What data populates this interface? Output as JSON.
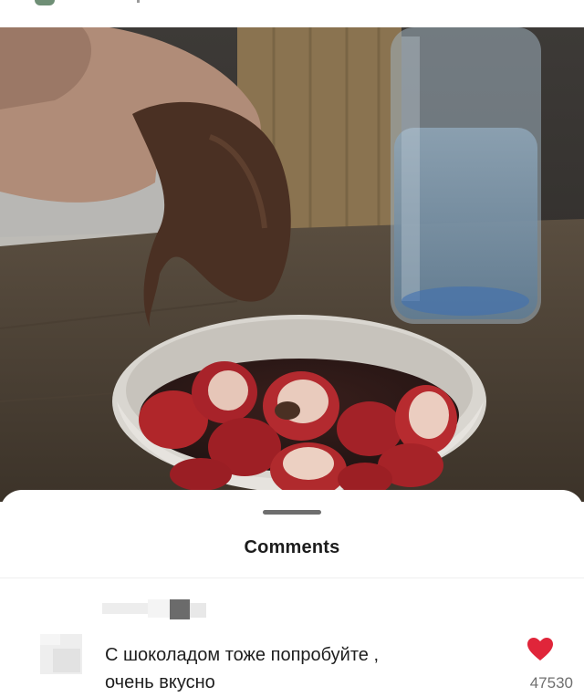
{
  "photo": {
    "alt": ""
  },
  "comments_sheet": {
    "title": "Comments",
    "comments": [
      {
        "text_line1": "С шоколадом тоже попробуйте ,",
        "text_line2": "очень вкусно",
        "likes": "47530"
      }
    ]
  },
  "colors": {
    "sheet_background": "#ffffff",
    "like_heart": "#e0253a",
    "handle": "#6e6e6e"
  },
  "icons": {
    "like": "heart-icon",
    "avatar": "avatar-placeholder",
    "app": "app-icon"
  }
}
